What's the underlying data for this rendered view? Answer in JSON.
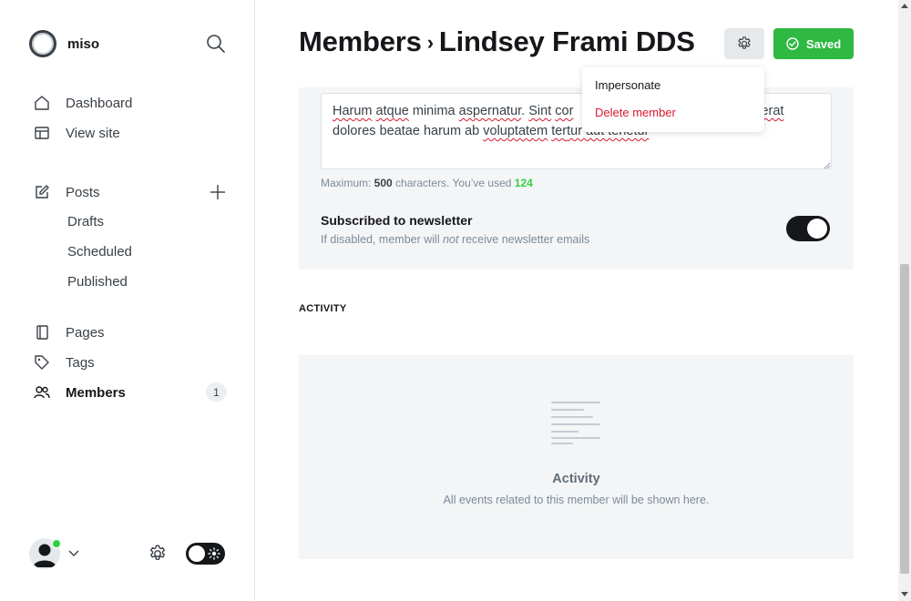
{
  "brand": {
    "name": "miso"
  },
  "nav": {
    "dashboard": "Dashboard",
    "view_site": "View site",
    "posts": "Posts",
    "drafts": "Drafts",
    "scheduled": "Scheduled",
    "published": "Published",
    "pages": "Pages",
    "tags": "Tags",
    "members": "Members",
    "members_count": "1"
  },
  "header": {
    "breadcrumb_parent": "Members",
    "breadcrumb_separator": "›",
    "title": "Lindsey Frami DDS",
    "saved_label": "Saved"
  },
  "dropdown": {
    "impersonate": "Impersonate",
    "delete_member": "Delete member"
  },
  "note": {
    "text_parts": [
      "Harum",
      " ",
      "atque",
      " minima ",
      "aspernatur",
      ". ",
      "Sint",
      " ",
      "cor",
      "",
      "",
      "erat",
      " dolores beatae harum ab ",
      "voluptatem",
      " ",
      "ter",
      "tur aut tenetur"
    ],
    "hint_prefix": "Maximum: ",
    "hint_max": "500",
    "hint_mid": " characters. You’ve used ",
    "hint_used": "124"
  },
  "newsletter": {
    "title": "Subscribed to newsletter",
    "desc_prefix": "If disabled, member will ",
    "desc_em": "not",
    "desc_suffix": " receive newsletter emails",
    "enabled": true
  },
  "activity": {
    "section_label": "ACTIVITY",
    "empty_title": "Activity",
    "empty_desc": "All events related to this member will be shown here."
  },
  "colors": {
    "accent_green": "#30cf43",
    "danger_red": "#d9182e",
    "text_dark": "#15171a"
  }
}
